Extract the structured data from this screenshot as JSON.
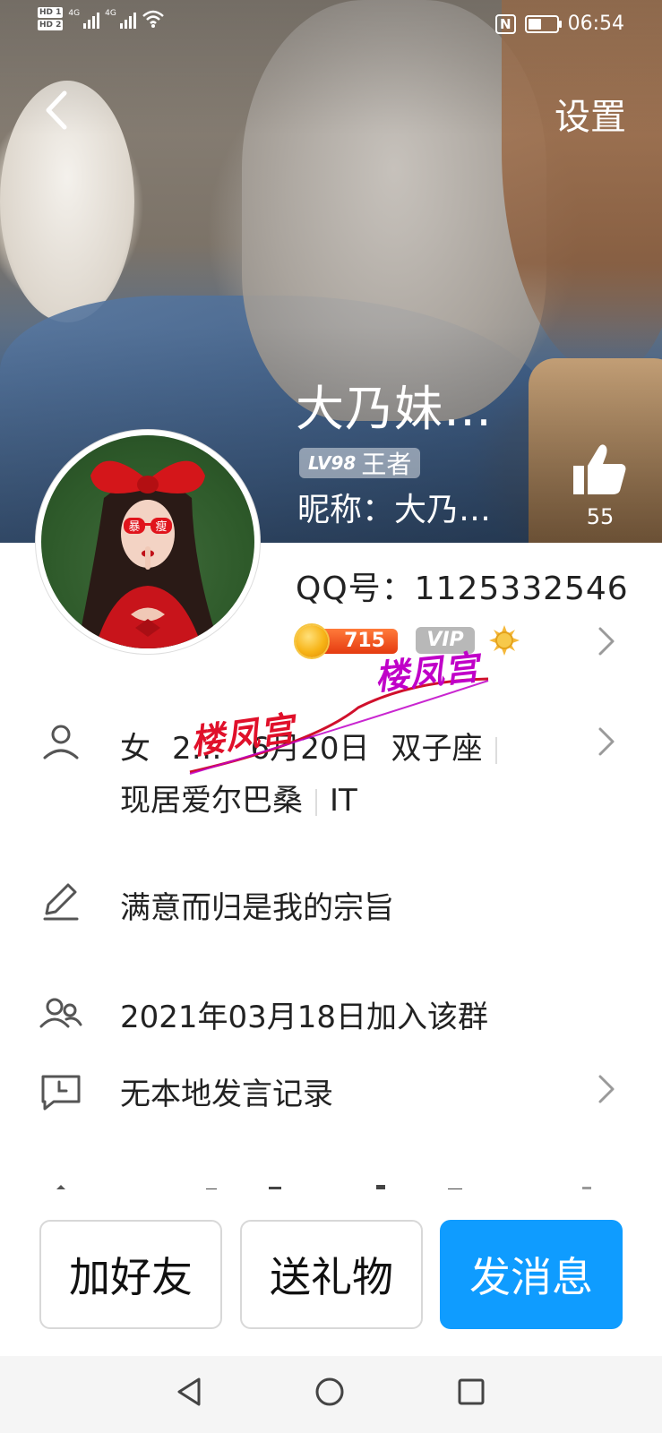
{
  "status_bar": {
    "sim1": "HD 1",
    "sim2": "HD 2",
    "net1": "4G",
    "net2": "4G",
    "nfc": "N",
    "time": "06:54"
  },
  "header": {
    "settings_label": "设置",
    "display_name": "大乃妹…",
    "level_code": "LV98",
    "level_rank": "王者",
    "nickname_line": "昵称：大乃…",
    "like_count": "55"
  },
  "profile": {
    "qq_line": "QQ号：1125332546",
    "coin_value": "715",
    "vip_label": "VIP",
    "basic_info": [
      "女",
      "2…",
      "6月20日",
      "双子座"
    ],
    "location": "现居爱尔巴桑",
    "occupation": "IT",
    "signature": "满意而归是我的宗旨",
    "joined": "2021年03月18日加入该群",
    "speech_record": "无本地发言记录"
  },
  "watermarks": {
    "mark1": "楼凤宫",
    "mark2": "楼凤宫",
    "color1": "#e0102a",
    "color2": "#c000c8"
  },
  "avatar": {
    "badge_text1": "暴",
    "badge_text2": "瘦"
  },
  "actions": {
    "add_friend": "加好友",
    "send_gift": "送礼物",
    "send_message": "发消息",
    "primary_color": "#0f9cff"
  }
}
